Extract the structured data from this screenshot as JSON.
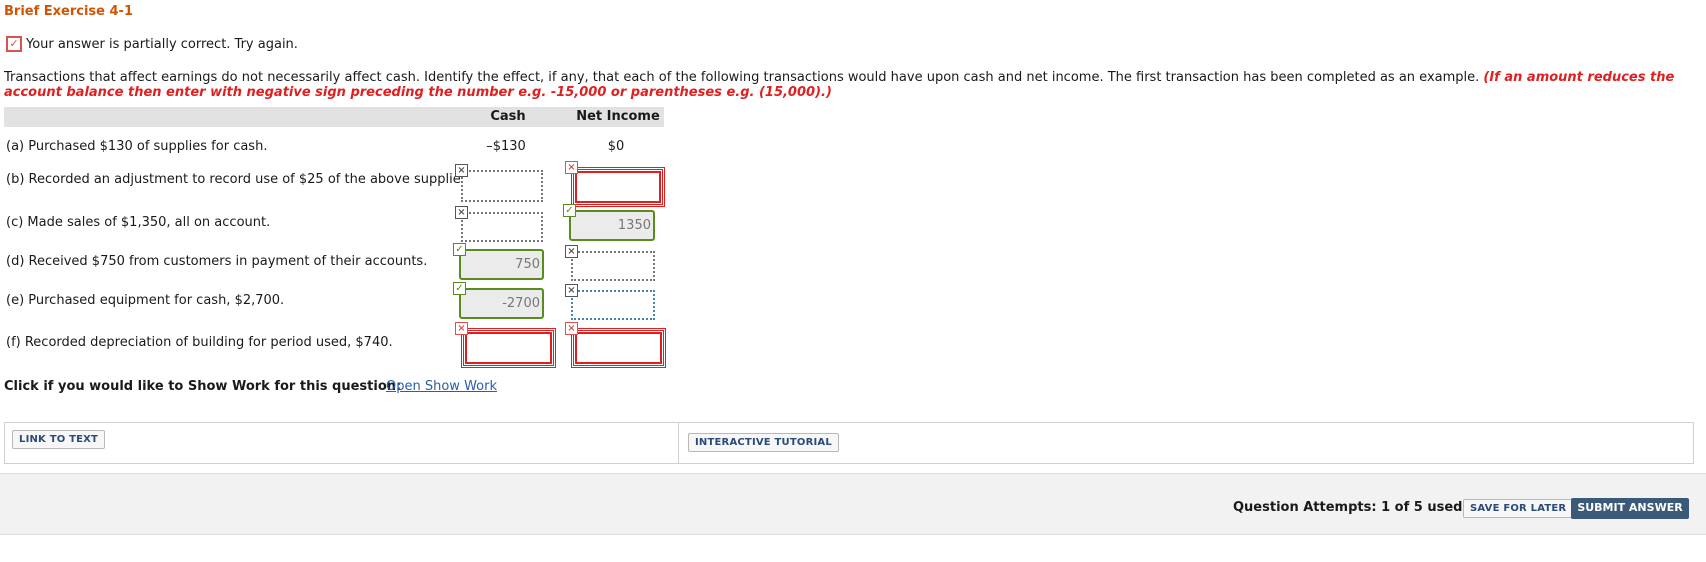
{
  "exercise": {
    "title": "Brief Exercise 4-1",
    "status_text": "Your answer is partially correct.  Try again.",
    "instructions": "Transactions that affect earnings do not necessarily affect cash. Identify the effect, if any, that each of the following transactions would have upon cash and net income. The first transaction has been completed as an example.",
    "instructions_note": "(If an amount reduces the account balance then enter with negative sign preceding the number e.g. -15,000 or parentheses e.g. (15,000).)"
  },
  "table": {
    "headers": {
      "cash": "Cash",
      "net_income": "Net Income"
    },
    "rows": [
      {
        "label": "(a) Purchased $130 of supplies for cash.",
        "cash": "–$130",
        "net_income": "$0"
      },
      {
        "label": "(b) Recorded an adjustment to record use of $25 of the above supplies.",
        "cash": "",
        "net_income": "",
        "cash_state": "none",
        "ni_state": "wrong"
      },
      {
        "label": "(c) Made sales of $1,350, all on account.",
        "cash": "",
        "net_income": "1350",
        "cash_state": "none",
        "ni_state": "right"
      },
      {
        "label": "(d) Received $750 from customers in payment of their accounts.",
        "cash": "750",
        "net_income": "",
        "cash_state": "right",
        "ni_state": "none"
      },
      {
        "label": "(e) Purchased equipment for cash, $2,700.",
        "cash": "-2700",
        "net_income": "",
        "cash_state": "right",
        "ni_state": "none"
      },
      {
        "label": "(f) Recorded depreciation of building for period used, $740.",
        "cash": "",
        "net_income": "",
        "cash_state": "wrong",
        "ni_state": "wrong"
      }
    ]
  },
  "show_work": {
    "prompt": "Click if you would like to Show Work for this question:",
    "link": "Open Show Work"
  },
  "tools": {
    "link_to_text": "LINK TO TEXT",
    "interactive_tutorial": "INTERACTIVE TUTORIAL"
  },
  "footer": {
    "attempts": "Question Attempts: 1 of 5 used",
    "save_for_later": "SAVE FOR LATER",
    "submit": "SUBMIT ANSWER"
  },
  "colors": {
    "title": "#d35400",
    "incorrect": "#e02020",
    "correct": "#5b8a1f",
    "submit_bg": "#3b5a7a"
  }
}
